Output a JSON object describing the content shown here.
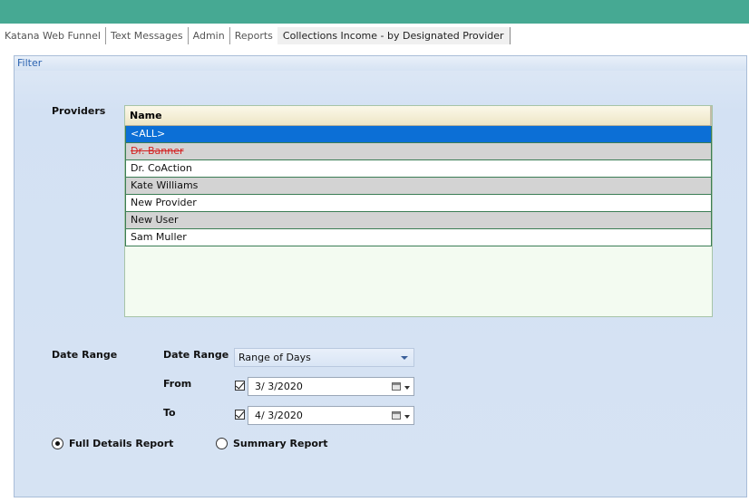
{
  "tabs": [
    {
      "label": "Katana Web Funnel"
    },
    {
      "label": "Text Messages"
    },
    {
      "label": "Admin"
    },
    {
      "label": "Reports"
    },
    {
      "label": "Collections Income - by Designated Provider"
    }
  ],
  "filter": {
    "title": "Filter",
    "providers_label": "Providers",
    "grid": {
      "column_header": "Name",
      "rows": [
        {
          "name": "<ALL>",
          "state": "selected"
        },
        {
          "name": "Dr. Banner",
          "state": "struck-through"
        },
        {
          "name": "Dr. CoAction",
          "state": "normal"
        },
        {
          "name": "Kate Williams",
          "state": "normal"
        },
        {
          "name": "New Provider",
          "state": "normal"
        },
        {
          "name": "New User",
          "state": "normal"
        },
        {
          "name": "Sam Muller",
          "state": "normal"
        }
      ]
    },
    "date_range_section_label": "Date Range",
    "date_range_field_label": "Date Range",
    "date_range_value": "Range of Days",
    "from_label": "From",
    "from_value": "3/  3/2020",
    "from_checked": true,
    "to_label": "To",
    "to_value": "4/  3/2020",
    "to_checked": true,
    "report_options": [
      {
        "label": "Full Details Report",
        "selected": true
      },
      {
        "label": "Summary Report",
        "selected": false
      }
    ]
  },
  "colors": {
    "topbar": "#46a993",
    "selected_row": "#0c6fd6",
    "filter_title": "#2a62b0",
    "struck_text": "#d42424"
  }
}
